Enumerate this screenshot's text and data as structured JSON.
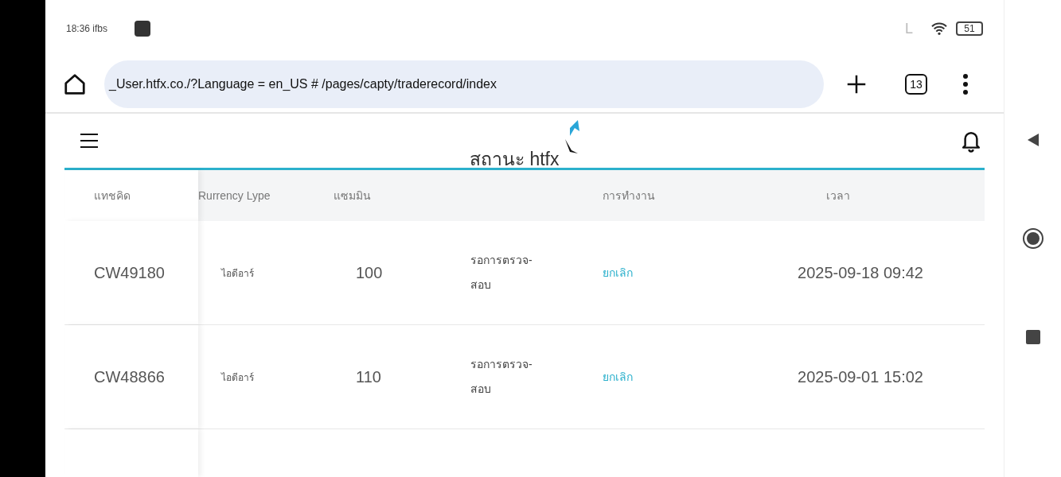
{
  "status_bar": {
    "time": "18:36 ifbs",
    "signal_letter": "L",
    "battery": "51"
  },
  "browser": {
    "url": "_User.htfx.co./?Language = en_US # /pages/capty/traderecord/index",
    "tab_count": "13"
  },
  "app_header": {
    "title": "สถานะ htfx"
  },
  "table": {
    "columns": [
      "แทชคิด",
      "Rurrency Lype",
      "แซมมิน",
      "",
      "การทำงาน",
      "เวลา"
    ],
    "rows": [
      {
        "id": "CW49180",
        "currency": "ไอดีอาร์",
        "amount": "100",
        "status_lines": [
          "รอการตรวจ-",
          "สอบ"
        ],
        "action": "ยกเลิก",
        "time": "2025-09-18 09:42"
      },
      {
        "id": "CW48866",
        "currency": "ไอดีอาร์",
        "amount": "110",
        "status_lines": [
          "รอการตรวจ-",
          "สอบ"
        ],
        "action": "ยกเลิก",
        "time": "2025-09-01 15:02"
      }
    ]
  }
}
